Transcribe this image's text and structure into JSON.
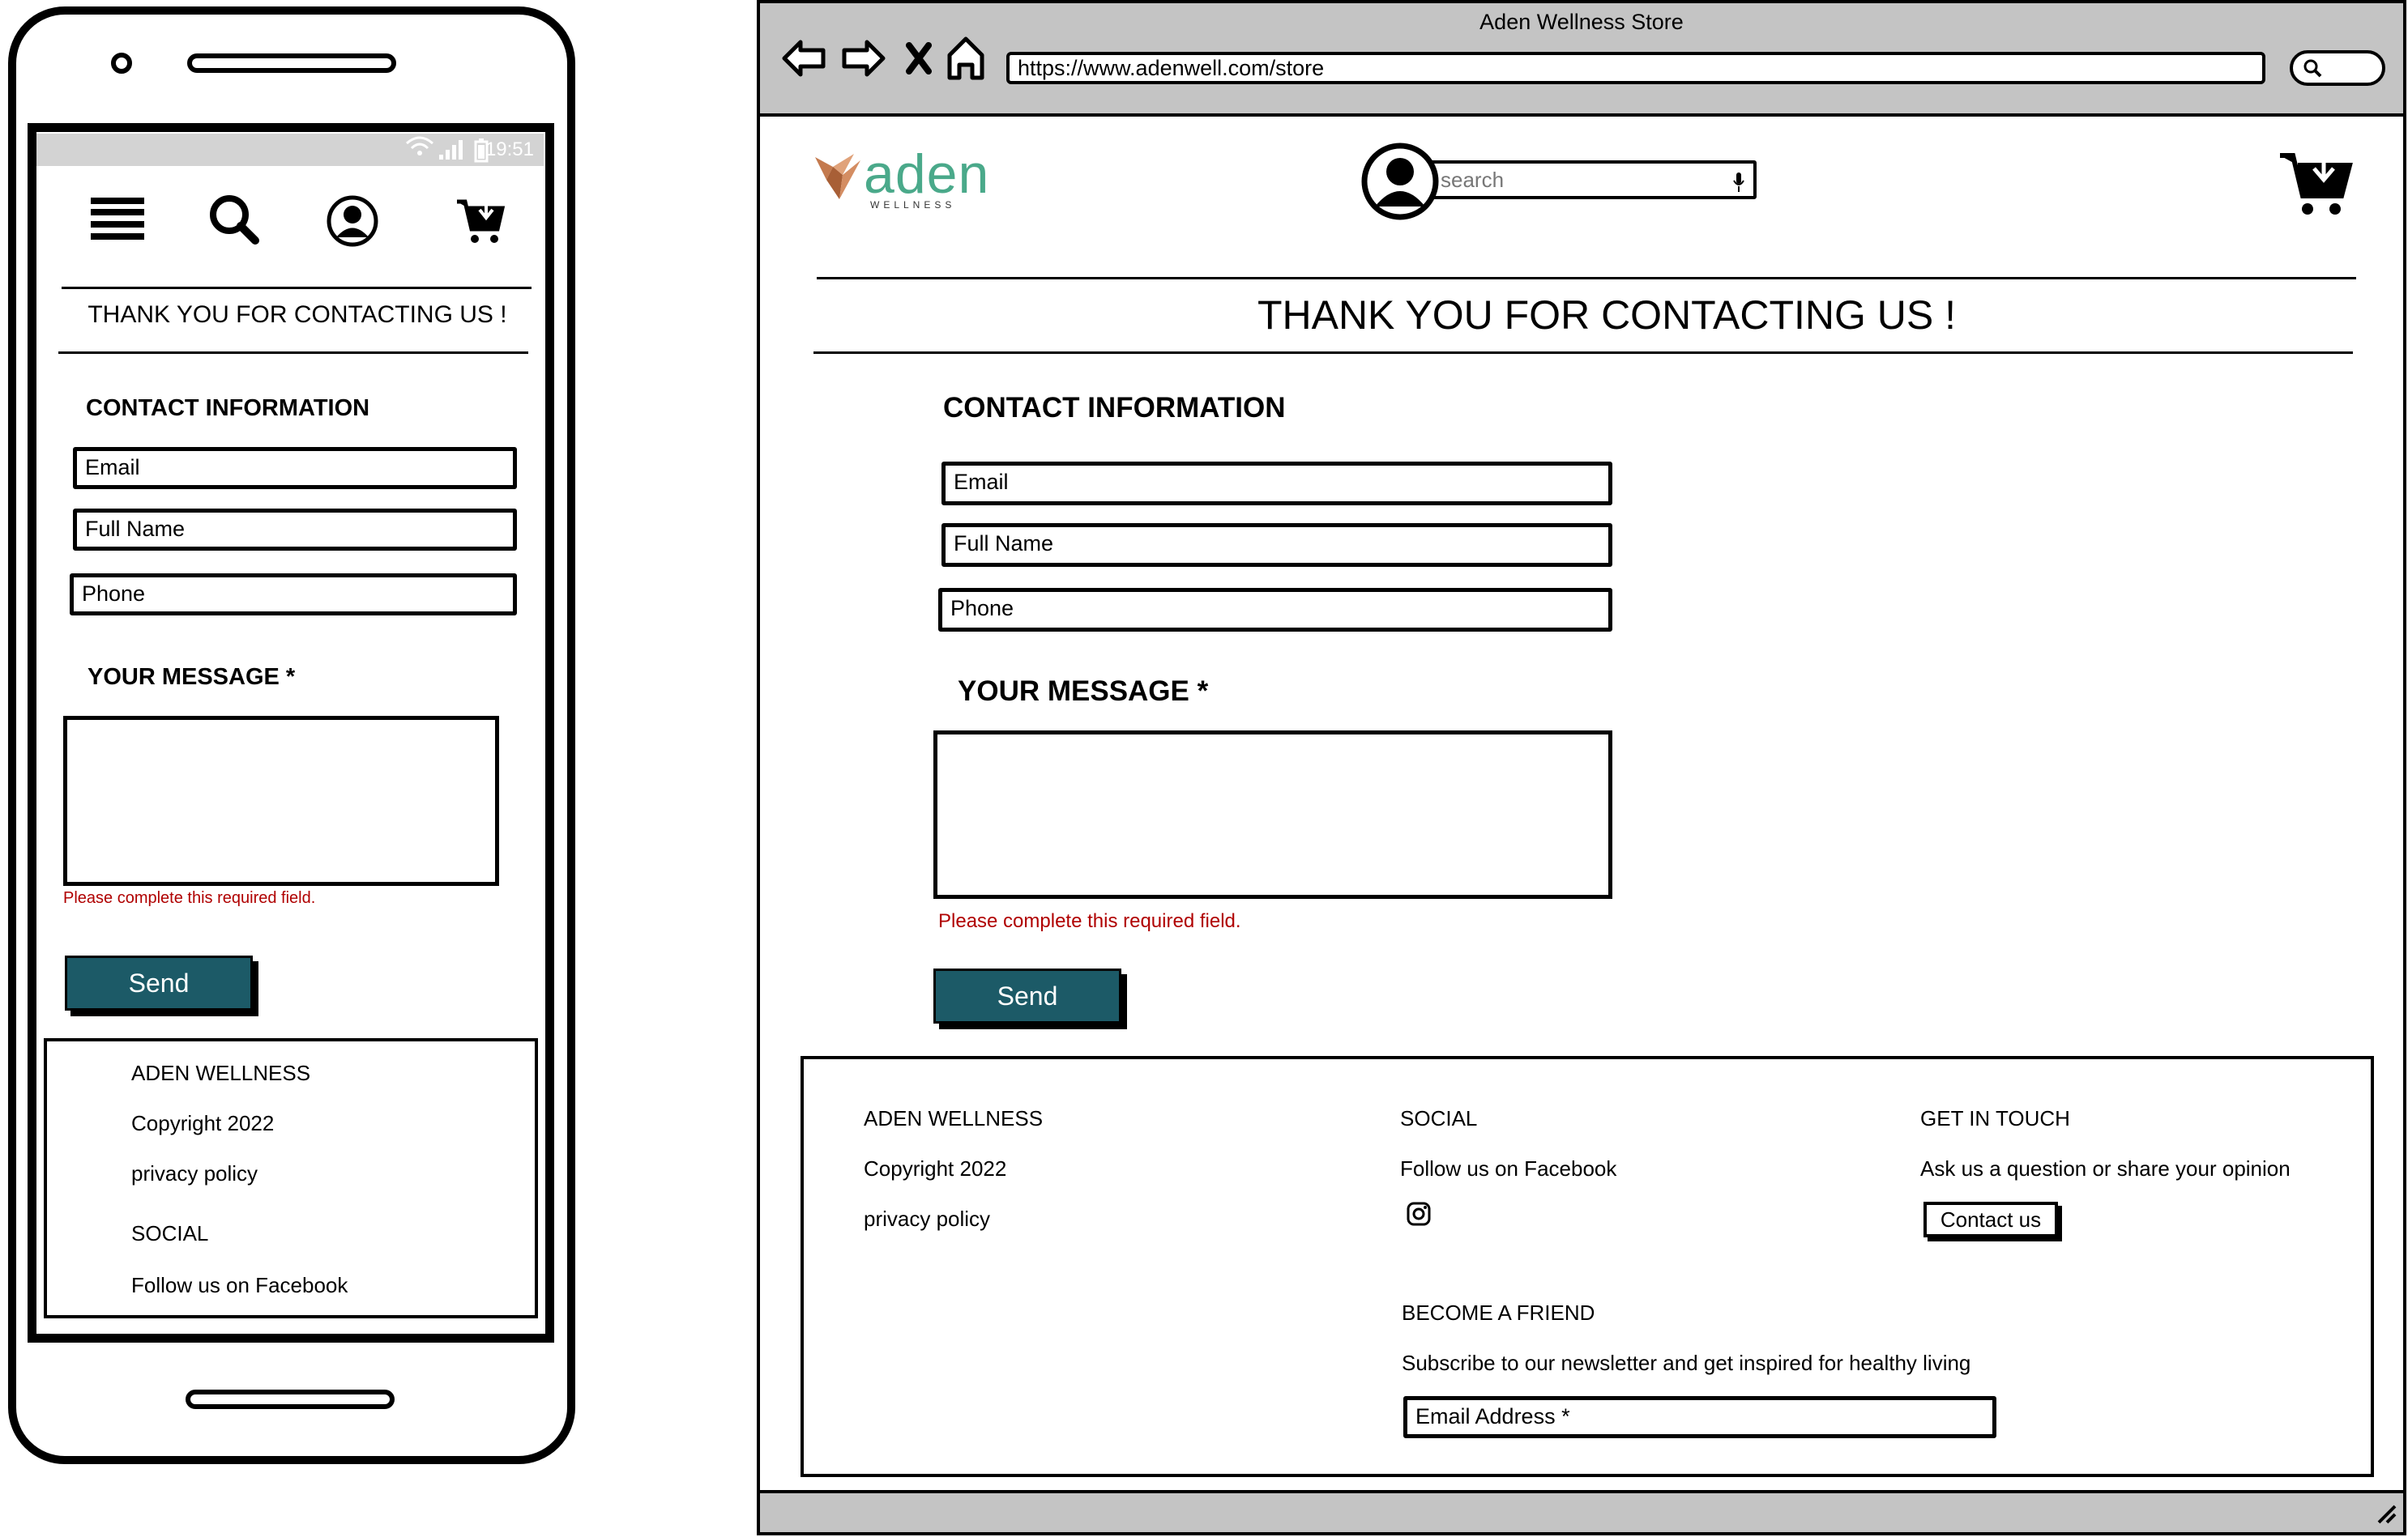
{
  "mobile": {
    "status_time": "19:51",
    "heading": "THANK YOU FOR CONTACTING US !",
    "contact_heading": "CONTACT INFORMATION",
    "fields": {
      "email": "Email",
      "full_name": "Full Name",
      "phone": "Phone"
    },
    "message_label": "YOUR MESSAGE *",
    "error": "Please complete this required field.",
    "send_label": "Send",
    "footer": {
      "brand": "ADEN WELLNESS",
      "copyright": "Copyright 2022",
      "privacy": "privacy policy",
      "social_title": "SOCIAL",
      "social_link": "Follow us on Facebook"
    }
  },
  "desktop": {
    "window_title": "Aden Wellness Store",
    "url": "https://www.adenwell.com/store",
    "logo": {
      "name": "aden",
      "tagline": "WELLNESS"
    },
    "search_placeholder": "search",
    "heading": "THANK YOU FOR CONTACTING US !",
    "contact_heading": "CONTACT INFORMATION",
    "fields": {
      "email": "Email",
      "full_name": "Full Name",
      "phone": "Phone"
    },
    "message_label": "YOUR MESSAGE *",
    "error": "Please complete this required field.",
    "send_label": "Send",
    "footer": {
      "brand": "ADEN WELLNESS",
      "copyright": "Copyright 2022",
      "privacy": "privacy policy",
      "social_title": "SOCIAL",
      "social_link": "Follow us on Facebook",
      "get_in_touch_title": "GET IN TOUCH",
      "get_in_touch_text": "Ask us a question or share your opinion",
      "contact_button": "Contact us",
      "friend_title": "BECOME A FRIEND",
      "friend_text": "Subscribe to our newsletter and get inspired for healthy living",
      "newsletter_placeholder": "Email Address *"
    }
  },
  "colors": {
    "button": "#1c5a67",
    "error": "#b00000",
    "logo_green": "#4aa98a",
    "logo_copper": "#c47a4e",
    "chrome": "#c4c4c4"
  },
  "icons": [
    "hamburger-menu-icon",
    "search-icon",
    "user-account-icon",
    "shopping-cart-icon",
    "back-arrow-icon",
    "forward-arrow-icon",
    "close-icon",
    "home-icon",
    "microphone-icon",
    "instagram-icon",
    "wifi-icon",
    "signal-icon",
    "battery-icon",
    "resize-grip-icon"
  ]
}
